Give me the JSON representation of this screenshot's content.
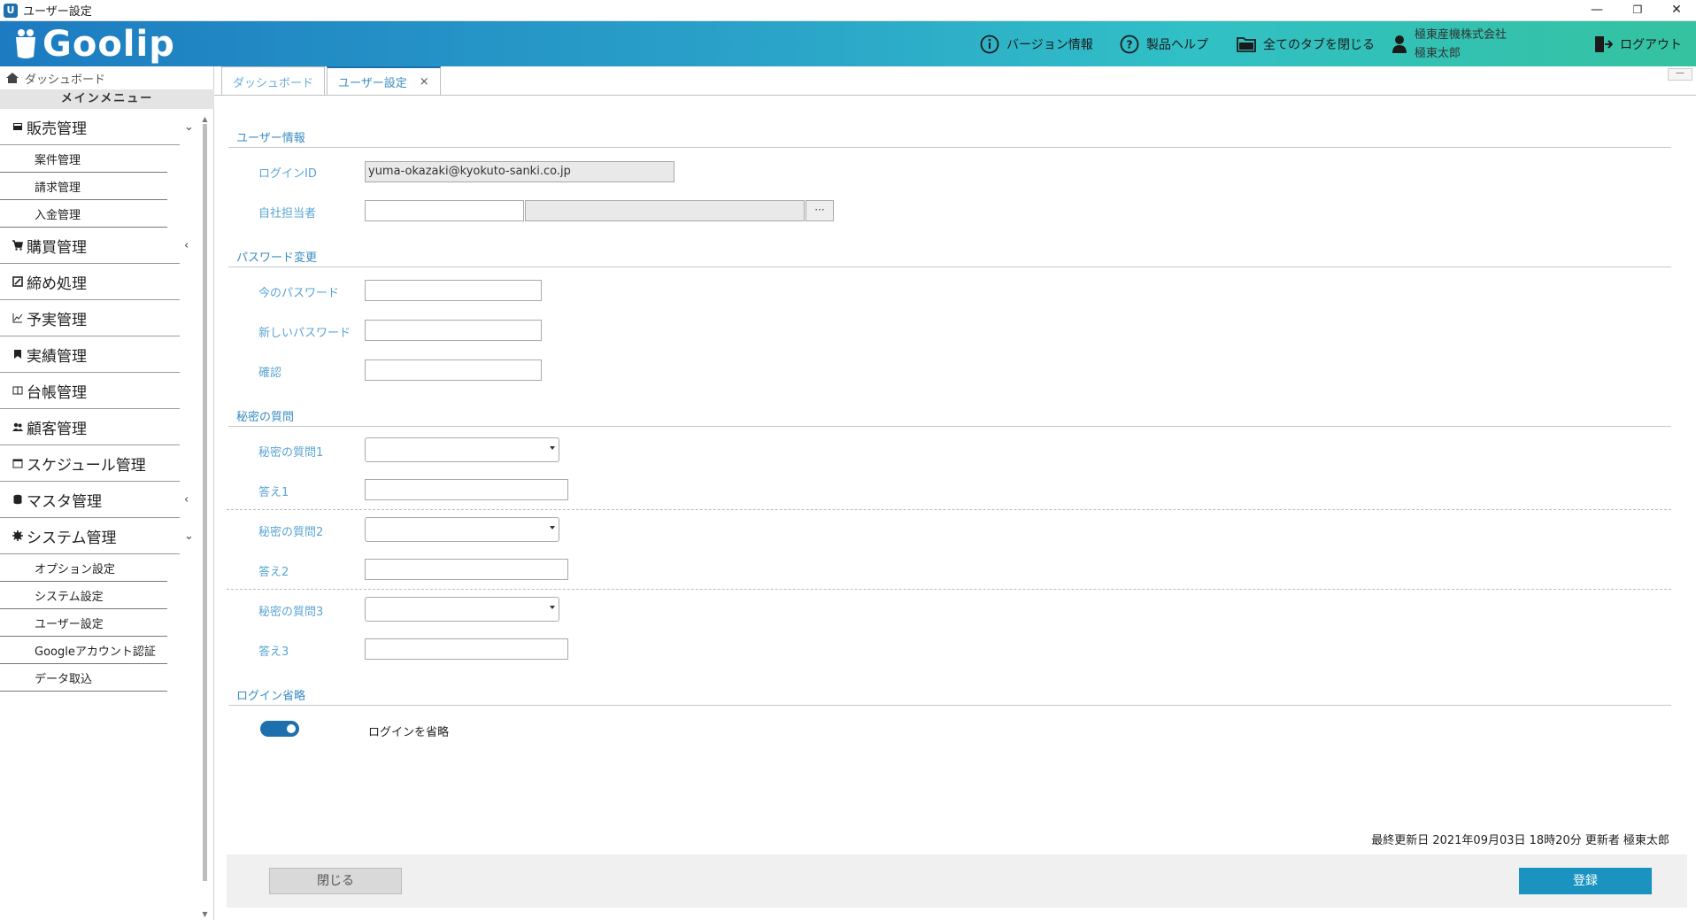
{
  "window": {
    "title": "ユーザー設定"
  },
  "header": {
    "logo_text": "Goolip",
    "version_label": "バージョン情報",
    "help_label": "製品ヘルプ",
    "close_tabs_label": "全てのタブを閉じる",
    "company": "極東産機株式会社",
    "user_name": "極東太郎",
    "logout_label": "ログアウト"
  },
  "sidebar": {
    "dashboard_label": "ダッシュボード",
    "menu_heading": "メインメニュー",
    "sales": {
      "label": "販売管理",
      "items": [
        "案件管理",
        "請求管理",
        "入金管理"
      ]
    },
    "purchase": "購買管理",
    "closing": "締め処理",
    "budget": "予実管理",
    "results": "実績管理",
    "ledger": "台帳管理",
    "customer": "顧客管理",
    "schedule": "スケジュール管理",
    "master": "マスタ管理",
    "system": {
      "label": "システム管理",
      "items": [
        "オプション設定",
        "システム設定",
        "ユーザー設定",
        "Googleアカウント認証",
        "データ取込"
      ]
    }
  },
  "tabs": [
    {
      "label": "ダッシュボード"
    },
    {
      "label": "ユーザー設定",
      "close": "×"
    }
  ],
  "form": {
    "user_info_title": "ユーザー情報",
    "login_id_label": "ログインID",
    "login_id_value": "yuma-okazaki@kyokuto-sanki.co.jp",
    "staff_label": "自社担当者",
    "staff_button": "···",
    "password_title": "パスワード変更",
    "current_password_label": "今のパスワード",
    "new_password_label": "新しいパスワード",
    "confirm_label": "確認",
    "secret_title": "秘密の質問",
    "q1_label": "秘密の質問1",
    "a1_label": "答え1",
    "q2_label": "秘密の質問2",
    "a2_label": "答え2",
    "q3_label": "秘密の質問3",
    "a3_label": "答え3",
    "skip_title": "ログイン省略",
    "skip_toggle_label": "ログインを省略",
    "skip_toggle_on": true
  },
  "footer": {
    "last_updated": "最終更新日 2021年09月03日 18時20分 更新者 極東太郎",
    "close_button": "閉じる",
    "save_button": "登録"
  },
  "colors": {
    "accent": "#1e6fae",
    "save": "#1b93c0",
    "label": "#5aa5d3"
  }
}
